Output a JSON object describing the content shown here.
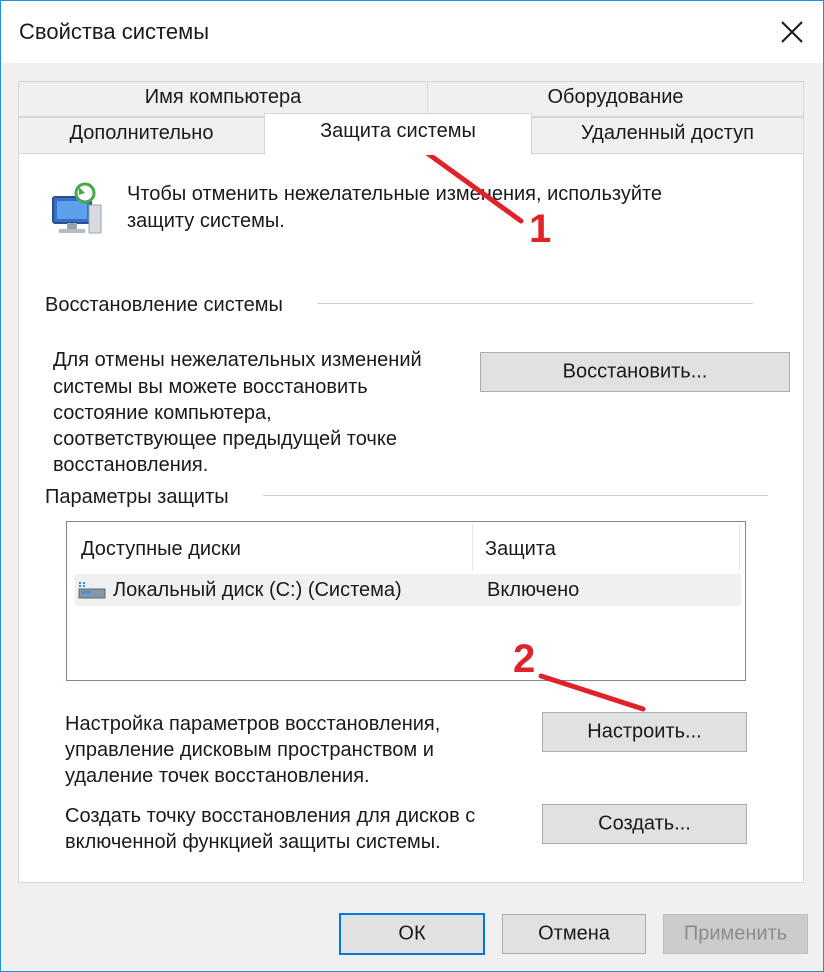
{
  "window": {
    "title": "Свойства системы",
    "close_icon": "close-icon",
    "accent_color": "#1f8fd8"
  },
  "tabs": {
    "row1": [
      "Имя компьютера",
      "Оборудование"
    ],
    "row2": [
      "Дополнительно",
      "Защита системы",
      "Удаленный доступ"
    ],
    "active": "Защита системы"
  },
  "intro": {
    "icon": "system-protection-icon",
    "text_line1": "Чтобы отменить нежелательные изменения, используйте",
    "text_line2": "защиту системы."
  },
  "restore_section": {
    "header": "Восстановление системы",
    "description": [
      "Для отмены нежелательных изменений",
      "системы вы можете восстановить",
      "состояние компьютера,",
      "соответствующее предыдущей точке",
      "восстановления."
    ],
    "button_label": "Восстановить..."
  },
  "protection_section": {
    "header": "Параметры защиты",
    "columns": [
      "Доступные диски",
      "Защита"
    ],
    "rows": [
      {
        "icon": "local-disk-icon",
        "drive": "Локальный диск (C:) (Система)",
        "protection": "Включено"
      }
    ]
  },
  "configure": {
    "description": [
      "Настройка параметров восстановления,",
      "управление дисковым пространством и",
      "удаление точек восстановления."
    ],
    "button_label": "Настроить..."
  },
  "create": {
    "description": [
      "Создать точку восстановления для дисков с",
      "включенной функцией защиты системы."
    ],
    "button_label": "Создать..."
  },
  "footer": {
    "ok": "ОК",
    "cancel": "Отмена",
    "apply": "Применить"
  },
  "annotations": {
    "label1": "1",
    "label2": "2",
    "color": "#e0222a"
  }
}
